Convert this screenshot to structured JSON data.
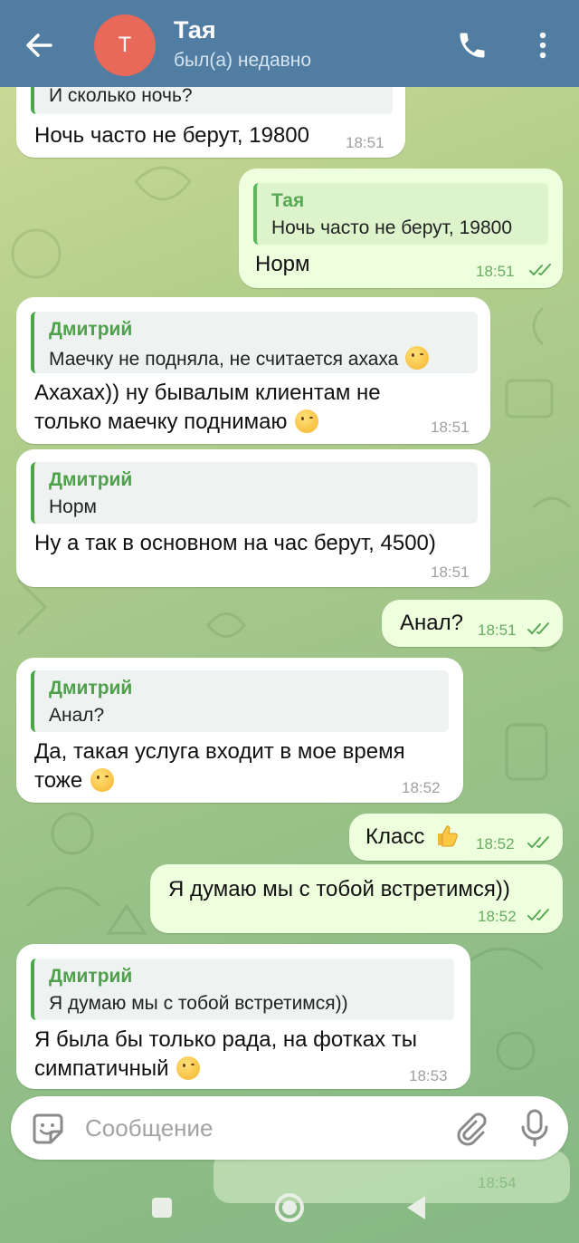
{
  "header": {
    "avatar_initial": "Т",
    "contact_name": "Тая",
    "contact_status": "был(а) недавно"
  },
  "messages": [
    {
      "direction": "in",
      "reply_text": "И сколько ночь?",
      "text": "Ночь часто не берут, 19800",
      "time": "18:51"
    },
    {
      "direction": "out",
      "reply_name": "Тая",
      "reply_text": "Ночь часто не берут, 19800",
      "text": "Норм",
      "time": "18:51",
      "read": true
    },
    {
      "direction": "in",
      "reply_name": "Дмитрий",
      "reply_text": "Маечку не подняла, не считается ахаха",
      "reply_emoji": "winking-face-with-tongue",
      "text_line1": "Ахахах)) ну бывалым клиентам не",
      "text_line2": "только маечку поднимаю",
      "emoji": "winking-face",
      "time": "18:51"
    },
    {
      "direction": "in",
      "reply_name": "Дмитрий",
      "reply_text": "Норм",
      "text": "Ну а так в основном на час берут, 4500)",
      "time": "18:51"
    },
    {
      "direction": "out",
      "text": "Анал?",
      "time": "18:51",
      "read": true
    },
    {
      "direction": "in",
      "reply_name": "Дмитрий",
      "reply_text": "Анал?",
      "text_line1": "Да, такая услуга входит в мое время",
      "text_line2": "тоже",
      "emoji": "winking-face",
      "time": "18:52"
    },
    {
      "direction": "out",
      "text": "Класс",
      "emoji": "thumbs-up",
      "time": "18:52",
      "read": true
    },
    {
      "direction": "out",
      "text": "Я думаю мы с тобой встретимся))",
      "time": "18:52",
      "read": true
    },
    {
      "direction": "in",
      "reply_name": "Дмитрий",
      "reply_text": "Я думаю мы с тобой встретимся))",
      "text_line1": "Я была бы только рада, на фотках ты",
      "text_line2": "симпатичный",
      "emoji": "smirking-face",
      "time": "18:53"
    }
  ],
  "ghost_message": {
    "time": "18:54"
  },
  "composer": {
    "placeholder": "Сообщение"
  },
  "colors": {
    "header": "#517da2",
    "incoming_bubble": "#ffffff",
    "outgoing_bubble": "#eeffde",
    "reply_accent": "#4ba547",
    "avatar": "#e8685a"
  }
}
